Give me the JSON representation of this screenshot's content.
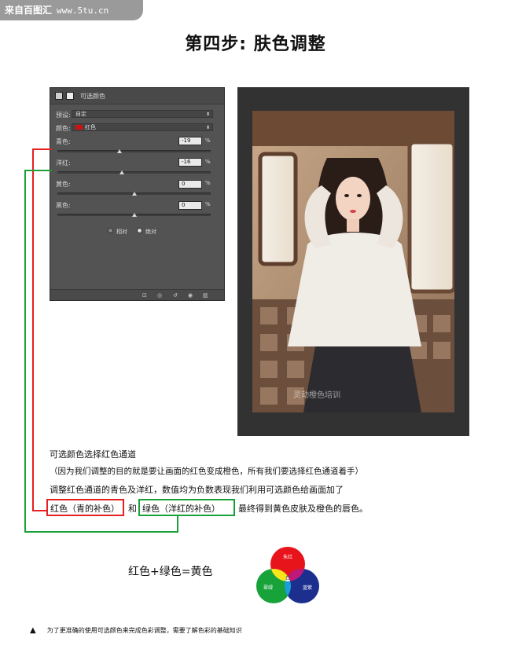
{
  "watermark": {
    "site_name": "来自百图汇",
    "url": "www.5tu.cn"
  },
  "title": "第四步:  肤色调整",
  "ps_panel": {
    "header_title": "可选颜色",
    "preset_label": "预设:",
    "preset_value": "自定",
    "colors_label": "颜色:",
    "colors_value": "红色",
    "color_swatch": "#d01010",
    "sliders": [
      {
        "label": "青色:",
        "value": "-19",
        "unit": "%",
        "level": 0.405
      },
      {
        "label": "洋红:",
        "value": "-16",
        "unit": "%",
        "level": 0.42
      },
      {
        "label": "黄色:",
        "value": "0",
        "unit": "%",
        "level": 0.5
      },
      {
        "label": "黑色:",
        "value": "0",
        "unit": "%",
        "level": 0.5
      }
    ],
    "method_options": [
      "相对",
      "绝对"
    ],
    "method_selected": "绝对",
    "bottom_icons": [
      "clip-icon",
      "visibility-link-icon",
      "reset-icon",
      "eye-icon",
      "trash-icon"
    ]
  },
  "photo": {
    "watermark_text": "灵动橙色培训"
  },
  "body_text": {
    "line1": "可选颜色选择红色通道",
    "line2": "（因为我们调整的目的就是要让画面的红色变成橙色，所有我们要选择红色通道着手）",
    "line3": "调整红色通道的青色及洋红，数值均为负数表现我们利用可选颜色给画面加了",
    "line4_red": "红色（青的补色）",
    "line4_and": "和",
    "line4_green": "绿色（洋红的补色）",
    "line4_end": "最终得到黄色皮肤及橙色的唇色。"
  },
  "formula": "红色+绿色=黄色",
  "venn": {
    "red_label": "朱红",
    "green_label": "翠绿",
    "blue_label": "蓝紫",
    "center_label": "白",
    "colors": {
      "red": "#e8141c",
      "green": "#18a33a",
      "blue": "#1c2f8e",
      "yellow": "#f7e61a",
      "magenta": "#c0187a",
      "cyan": "#19a0d8"
    }
  },
  "footer_note": "为了更准确的使用可选颜色来完成色彩调整，需要了解色彩的基础知识",
  "accent_colors": {
    "red_line": "#e52020",
    "green_line": "#19a039"
  }
}
